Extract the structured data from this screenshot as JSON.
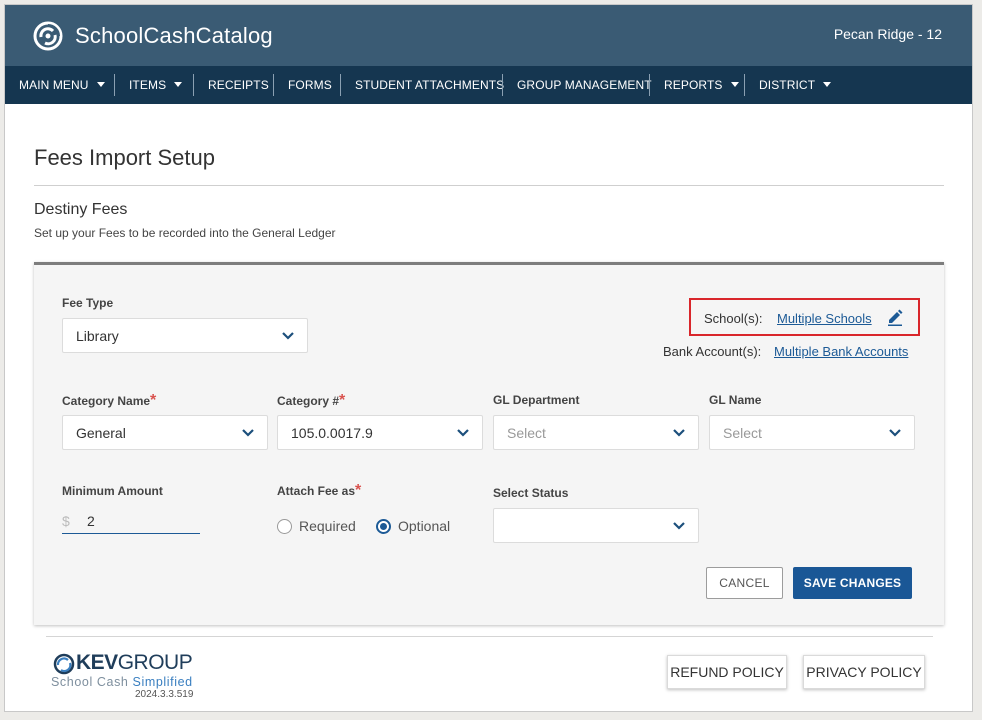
{
  "header": {
    "brand": "SchoolCashCatalog",
    "school": "Pecan Ridge - 12",
    "logo_icon": "swirl-logo-icon"
  },
  "nav": {
    "items": [
      {
        "label": "MAIN MENU",
        "dropdown": true
      },
      {
        "label": "ITEMS",
        "dropdown": true
      },
      {
        "label": "RECEIPTS",
        "dropdown": false
      },
      {
        "label": "FORMS",
        "dropdown": false
      },
      {
        "label": "STUDENT ATTACHMENTS",
        "dropdown": false
      },
      {
        "label": "GROUP MANAGEMENT",
        "dropdown": false
      },
      {
        "label": "REPORTS",
        "dropdown": true
      },
      {
        "label": "DISTRICT",
        "dropdown": true
      }
    ]
  },
  "page": {
    "title": "Fees Import Setup",
    "section_title": "Destiny Fees",
    "section_desc": "Set up your Fees to be recorded into the General Ledger"
  },
  "form": {
    "fee_type": {
      "label": "Fee Type",
      "value": "Library"
    },
    "schools": {
      "label": "School(s):",
      "link": "Multiple Schools"
    },
    "bank_accounts": {
      "label": "Bank Account(s):",
      "link": "Multiple Bank Accounts"
    },
    "category_name": {
      "label": "Category Name",
      "value": "General",
      "required_mark": "*"
    },
    "category_number": {
      "label": "Category #",
      "value": "105.0.0017.9",
      "required_mark": "*"
    },
    "gl_department": {
      "label": "GL Department",
      "placeholder": "Select"
    },
    "gl_name": {
      "label": "GL Name",
      "placeholder": "Select"
    },
    "minimum_amount": {
      "label": "Minimum Amount",
      "currency": "$",
      "value": "2"
    },
    "attach_fee_as": {
      "label": "Attach Fee as",
      "required_mark": "*",
      "options": [
        "Required",
        "Optional"
      ],
      "selected": "Optional"
    },
    "select_status": {
      "label": "Select Status",
      "value": ""
    },
    "cancel_label": "CANCEL",
    "save_label": "SAVE CHANGES"
  },
  "footer": {
    "logo_word_bold": "KEV",
    "logo_word_thin": "GROUP",
    "tagline_a": "School Cash ",
    "tagline_b": "Simplified",
    "version": "2024.3.3.519",
    "refund_label": "REFUND POLICY",
    "privacy_label": "PRIVACY POLICY"
  },
  "colors": {
    "header_bg": "#3a5b74",
    "nav_bg": "#153650",
    "link": "#1c5a96",
    "primary_button": "#1a5796",
    "highlight_box": "#d9262b",
    "required_mark": "#d9534f"
  }
}
